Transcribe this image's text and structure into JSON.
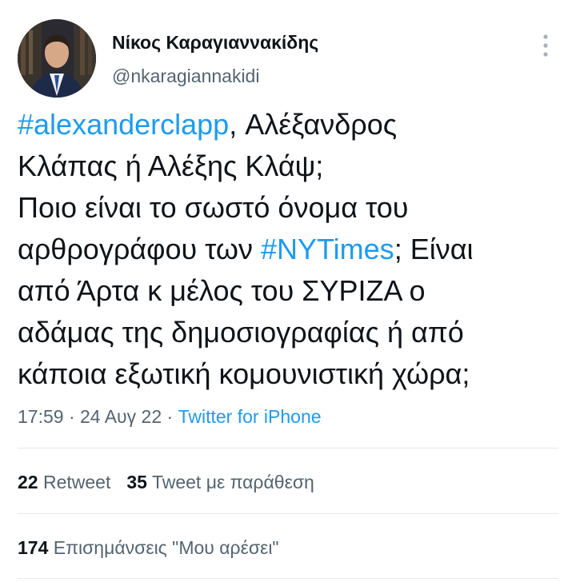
{
  "author": {
    "display_name": "Νίκος Καραγιαννακίδης",
    "handle": "@nkaragiannakidi"
  },
  "tweet": {
    "lines": [
      [
        {
          "text": "#alexanderclapp",
          "hashtag": true
        },
        {
          "text": ", Αλέξανδρος",
          "hashtag": false
        }
      ],
      [
        {
          "text": "Κλάπας ή Αλέξης Κλάψ;",
          "hashtag": false
        }
      ],
      [
        {
          "text": "Ποιο είναι το σωστό όνομα του",
          "hashtag": false
        }
      ],
      [
        {
          "text": "αρθρογράφου των ",
          "hashtag": false
        },
        {
          "text": "#NYTimes",
          "hashtag": true
        },
        {
          "text": "; Είναι",
          "hashtag": false
        }
      ],
      [
        {
          "text": "από Άρτα κ μέλος του ΣΥΡΙΖΑ ο",
          "hashtag": false
        }
      ],
      [
        {
          "text": "αδάμας της δημοσιογραφίας ή από",
          "hashtag": false
        }
      ],
      [
        {
          "text": "κάποια εξωτική κομουνιστική χώρα;",
          "hashtag": false
        }
      ]
    ]
  },
  "meta": {
    "time": "17:59",
    "date": "24 Αυγ 22",
    "separator": " · ",
    "source": "Twitter for iPhone"
  },
  "stats": {
    "retweets_count": "22",
    "retweets_label": "Retweet",
    "quotes_count": "35",
    "quotes_label": "Tweet με παράθεση",
    "likes_count": "174",
    "likes_label": "Επισημάνσεις \"Μου αρέσει\""
  },
  "icons": {
    "more": "more-vertical-icon",
    "avatar": "profile-photo"
  },
  "colors": {
    "link": "#1d9bf0",
    "secondary_text": "#536471",
    "primary_text": "#0f1419",
    "divider": "#e6e9eb"
  }
}
